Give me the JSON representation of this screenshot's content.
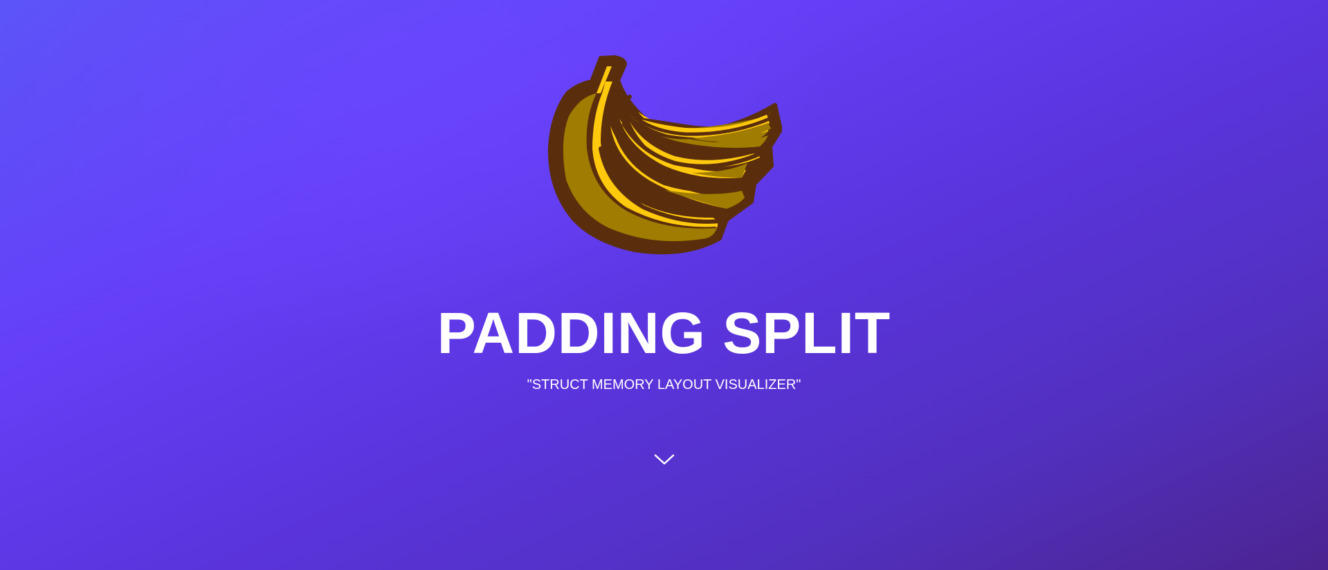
{
  "hero": {
    "logo_icon": "banana-bunch-icon",
    "title": "PADDING SPLIT",
    "subtitle": "\"STRUCT MEMORY LAYOUT VISUALIZER\"",
    "scroll_icon": "chevron-down-icon"
  },
  "colors": {
    "background_start": "#5b55f8",
    "background_mid": "#6540f8",
    "background_end": "#4b2490",
    "text": "#ffffff",
    "banana_yellow": "#ffc90e",
    "banana_shadow": "#a07c00",
    "banana_outline": "#5a2e0c"
  }
}
